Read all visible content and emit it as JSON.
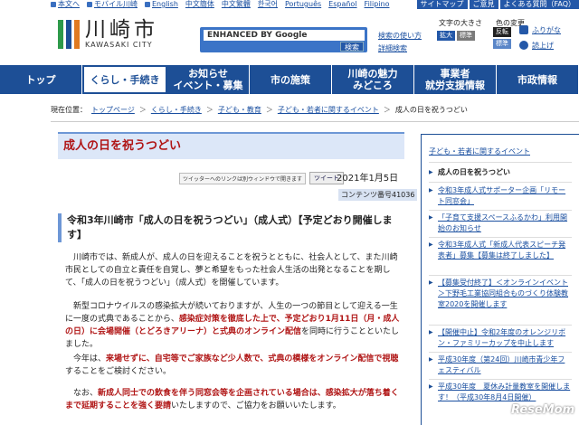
{
  "topbar": {
    "links": [
      "本文へ",
      "モバイル川崎",
      "English",
      "中文簡体",
      "中文繁體",
      "한국어",
      "Português",
      "Español",
      "Filipino"
    ],
    "right_links": [
      "サイトマップ",
      "ご意見",
      "よくある質問（FAQ）"
    ]
  },
  "logo": {
    "name": "川崎市",
    "en": "KAWASAKI CITY",
    "bar_colors": [
      "#2e9a4a",
      "#1d4f96",
      "#e07a20"
    ]
  },
  "search": {
    "provider": "ENHANCED BY Google",
    "button": "検索",
    "help": "検索の使い方",
    "multi": "詳細検索"
  },
  "access": {
    "font_size_label": "文字の大きさ",
    "enlarge": "拡大",
    "standard": "標準",
    "color_label": "色の変更",
    "inverted": "反転",
    "original": "標準",
    "furigana": "ふりがな",
    "read_aloud": "読上げ"
  },
  "nav": [
    {
      "label": "トップ"
    },
    {
      "label": "くらし・手続き"
    },
    {
      "label": "お知らせ\nイベント・募集"
    },
    {
      "label": "市の施策"
    },
    {
      "label": "川崎の魅力\nみどころ"
    },
    {
      "label": "事業者\n就労支援情報"
    },
    {
      "label": "市政情報"
    }
  ],
  "breadcrumb": {
    "label": "現在位置：",
    "items": [
      "トップページ",
      "くらし・手続き",
      "子ども・教育",
      "子ども・若者に関するイベント",
      "成人の日を祝うつどい"
    ]
  },
  "page": {
    "title": "成人の日を祝うつどい",
    "tweet_note": "ツイッターへのリンクは別ウィンドウで開きます",
    "tweet_button": "ツイート",
    "date": "2021年1月5日",
    "content_no": "コンテンツ番号41036",
    "heading": "令和3年川崎市「成人の日を祝うつどい」（成人式）【予定どおり開催します】",
    "p1": "川崎市では、新成人が、成人の日を迎えることを祝うとともに、社会人として、また川崎市民としての自立と責任を自覚し、夢と希望をもった社会人生活の出発となることを期して、「成人の日を祝うつどい」（成人式）を開催しています。",
    "p2a": "新型コロナウイルスの感染拡大が続いておりますが、人生の一つの節目として迎える一生に一度の式典であることから、",
    "p2b": "感染症対策を徹底した上で、予定どおり1月11日（月・成人の日）に会場開催（とどろきアリーナ）と式典のオンライン配信",
    "p2c": "を同時に行うことといたしました。",
    "p3a": "今年は、",
    "p3b": "来場せずに、自宅等でご家族など少人数で、式典の模様をオンライン配信で視聴",
    "p3c": "することをご検討ください。",
    "p4a": "なお、",
    "p4b": "新成人同士での飲食を伴う同窓会等を企画されている場合は、感染拡大が落ち着くまで延期することを強く要請",
    "p4c": "いたしますので、ご協力をお願いいたします。"
  },
  "sidebar": {
    "category": "子ども・若者に関するイベント",
    "items": [
      "成人の日を祝うつどい",
      "令和3年成人式サポーター企画「リモート同窓会」",
      "「子育て支援スペースふるかわ」利用開始のお知らせ",
      "令和3年成人式「新成人代表スピーチ発表者」募集【募集は終了しました】",
      "【募集受付終了】＜オンラインイベント＞下野毛工業協同組合ものづくり体験教室2020を開催します",
      "【開催中止】令和2年度のオレンジリボン・ファミリーカップを中止します",
      "平成30年度（第24回）川崎市青少年フェスティバル",
      "平成30年度　夏休み計量教室を開催します！（平成30年8月4日開催）"
    ]
  },
  "watermark": "ReseMom"
}
